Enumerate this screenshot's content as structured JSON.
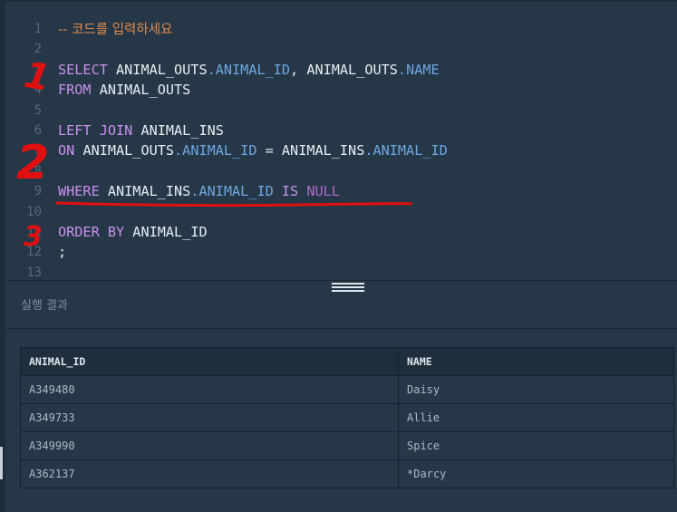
{
  "editor": {
    "lines": [
      {
        "n": "1",
        "tokens": [
          {
            "t": "-- 코드를 입력하세요",
            "c": "comment"
          }
        ]
      },
      {
        "n": "2",
        "tokens": []
      },
      {
        "n": "3",
        "tokens": [
          {
            "t": "SELECT ",
            "c": "kw"
          },
          {
            "t": "ANIMAL_OUTS",
            "c": "id"
          },
          {
            "t": ".ANIMAL_ID",
            "c": "field"
          },
          {
            "t": ", ",
            "c": "id"
          },
          {
            "t": "ANIMAL_OUTS",
            "c": "id"
          },
          {
            "t": ".NAME",
            "c": "field"
          }
        ]
      },
      {
        "n": "4",
        "tokens": [
          {
            "t": "FROM ",
            "c": "kw"
          },
          {
            "t": "ANIMAL_OUTS",
            "c": "id"
          }
        ]
      },
      {
        "n": "5",
        "tokens": []
      },
      {
        "n": "6",
        "tokens": [
          {
            "t": "LEFT JOIN ",
            "c": "kw"
          },
          {
            "t": "ANIMAL_INS",
            "c": "id"
          }
        ]
      },
      {
        "n": "7",
        "tokens": [
          {
            "t": "ON ",
            "c": "kw"
          },
          {
            "t": "ANIMAL_OUTS",
            "c": "id"
          },
          {
            "t": ".ANIMAL_ID",
            "c": "field"
          },
          {
            "t": " = ",
            "c": "id"
          },
          {
            "t": "ANIMAL_INS",
            "c": "id"
          },
          {
            "t": ".ANIMAL_ID",
            "c": "field"
          }
        ]
      },
      {
        "n": "8",
        "tokens": []
      },
      {
        "n": "9",
        "tokens": [
          {
            "t": "WHERE ",
            "c": "kw"
          },
          {
            "t": "ANIMAL_INS",
            "c": "id"
          },
          {
            "t": ".ANIMAL_ID",
            "c": "field"
          },
          {
            "t": " ",
            "c": "id"
          },
          {
            "t": "IS",
            "c": "kw"
          },
          {
            "t": " ",
            "c": "id"
          },
          {
            "t": "NULL",
            "c": "null"
          }
        ]
      },
      {
        "n": "10",
        "tokens": []
      },
      {
        "n": "11",
        "tokens": [
          {
            "t": "ORDER BY ",
            "c": "kw"
          },
          {
            "t": "ANIMAL_ID",
            "c": "id"
          }
        ]
      },
      {
        "n": "12",
        "tokens": [
          {
            "t": ";",
            "c": "id"
          }
        ]
      },
      {
        "n": "13",
        "tokens": []
      }
    ]
  },
  "annotations": {
    "marks": [
      "1",
      "2",
      "3"
    ],
    "color": "#e01010"
  },
  "result": {
    "title": "실행 결과",
    "columns": [
      "ANIMAL_ID",
      "NAME"
    ],
    "rows": [
      [
        "A349480",
        "Daisy"
      ],
      [
        "A349733",
        "Allie"
      ],
      [
        "A349990",
        "Spice"
      ],
      [
        "A362137",
        "*Darcy"
      ]
    ]
  }
}
